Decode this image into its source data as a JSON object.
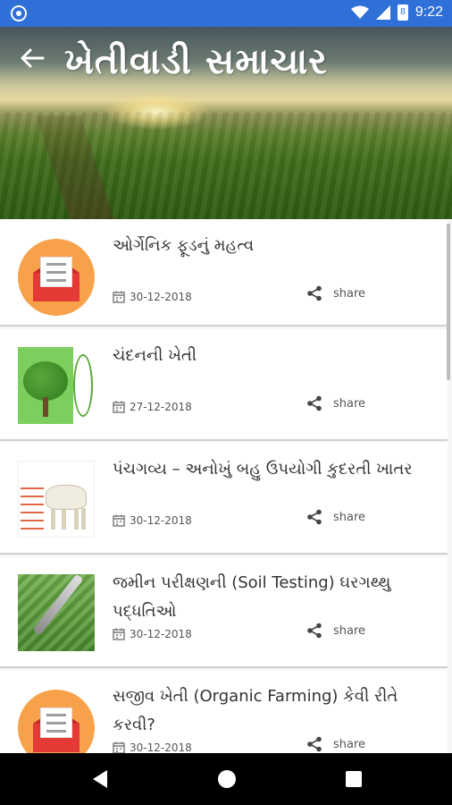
{
  "status_bar": {
    "time": "9:22",
    "battery": "8"
  },
  "header": {
    "title": "ખેતીવાડી સમાચાર",
    "back_icon": "arrow-left-icon"
  },
  "share_label": "share",
  "articles": [
    {
      "title": "ઓર્ગેનિક ફૂડનું મહત્વ",
      "date": "30-12-2018",
      "thumb": "mail-icon"
    },
    {
      "title": "ચંદનની ખેતી",
      "date": "27-12-2018",
      "thumb": "sandalwood-tree-image"
    },
    {
      "title": "પંચગવ્ય – અનોખું બહુ ઉપયોગી કુદરતી ખાતર",
      "date": "30-12-2018",
      "thumb": "cow-image"
    },
    {
      "title": "જમીન પરીક્ષણની (Soil Testing) ઘરગથ્થુ પદ્ધતિઓ",
      "date": "30-12-2018",
      "thumb": "soil-testing-image"
    },
    {
      "title": "સજીવ ખેતી (Organic Farming) કેવી રીતે કરવી?",
      "date": "30-12-2018",
      "thumb": "mail-icon"
    }
  ],
  "colors": {
    "status_bar": "#2e6fd8",
    "nav_bar": "#000000",
    "mail_circle": "#f7a24a",
    "envelope": "#e53935"
  }
}
